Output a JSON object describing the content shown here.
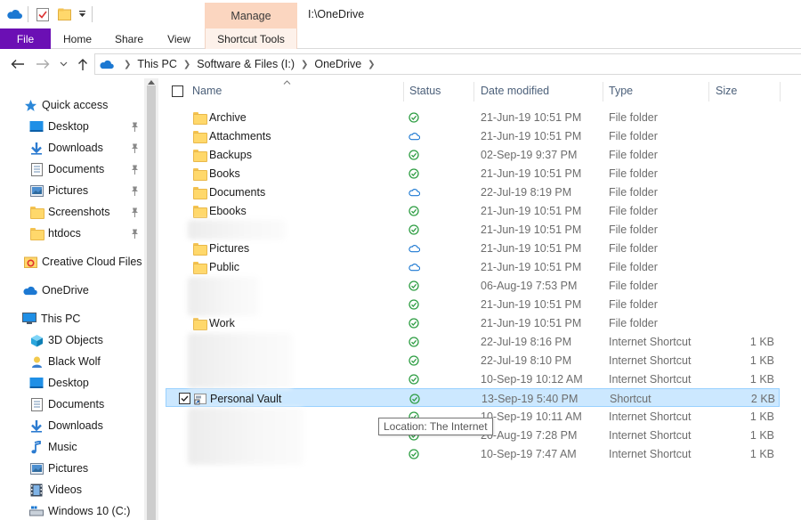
{
  "window": {
    "title": "I:\\OneDrive",
    "manage_tab": "Manage"
  },
  "ribbon": {
    "tabs": [
      "File",
      "Home",
      "Share",
      "View",
      "Shortcut Tools"
    ]
  },
  "address": {
    "crumbs": [
      "This PC",
      "Software & Files (I:)",
      "OneDrive"
    ]
  },
  "navpane": {
    "quick_access": "Quick access",
    "pinned": [
      "Desktop",
      "Downloads",
      "Documents",
      "Pictures",
      "Screenshots",
      "htdocs"
    ],
    "creative_cloud": "Creative Cloud Files",
    "onedrive": "OneDrive",
    "this_pc": "This PC",
    "this_pc_items": [
      "3D Objects",
      "Black Wolf",
      "Desktop",
      "Documents",
      "Downloads",
      "Music",
      "Pictures",
      "Videos",
      "Windows 10 (C:)"
    ]
  },
  "columns": {
    "name": "Name",
    "status": "Status",
    "date": "Date modified",
    "type": "Type",
    "size": "Size"
  },
  "files": [
    {
      "name": "Archive",
      "status": "synced",
      "date": "21-Jun-19 10:51 PM",
      "type": "File folder",
      "size": ""
    },
    {
      "name": "Attachments",
      "status": "cloud",
      "date": "21-Jun-19 10:51 PM",
      "type": "File folder",
      "size": ""
    },
    {
      "name": "Backups",
      "status": "synced",
      "date": "02-Sep-19 9:37 PM",
      "type": "File folder",
      "size": ""
    },
    {
      "name": "Books",
      "status": "synced",
      "date": "21-Jun-19 10:51 PM",
      "type": "File folder",
      "size": ""
    },
    {
      "name": "Documents",
      "status": "cloud",
      "date": "22-Jul-19 8:19 PM",
      "type": "File folder",
      "size": ""
    },
    {
      "name": "Ebooks",
      "status": "synced",
      "date": "21-Jun-19 10:51 PM",
      "type": "File folder",
      "size": ""
    },
    {
      "name": "",
      "status": "synced",
      "date": "21-Jun-19 10:51 PM",
      "type": "File folder",
      "size": ""
    },
    {
      "name": "Pictures",
      "status": "cloud",
      "date": "21-Jun-19 10:51 PM",
      "type": "File folder",
      "size": ""
    },
    {
      "name": "Public",
      "status": "cloud",
      "date": "21-Jun-19 10:51 PM",
      "type": "File folder",
      "size": ""
    },
    {
      "name": "",
      "status": "synced",
      "date": "06-Aug-19 7:53 PM",
      "type": "File folder",
      "size": ""
    },
    {
      "name": "",
      "status": "synced",
      "date": "21-Jun-19 10:51 PM",
      "type": "File folder",
      "size": ""
    },
    {
      "name": "Work",
      "status": "synced",
      "date": "21-Jun-19 10:51 PM",
      "type": "File folder",
      "size": ""
    },
    {
      "name": "",
      "status": "synced",
      "date": "22-Jul-19 8:16 PM",
      "type": "Internet Shortcut",
      "size": "1 KB"
    },
    {
      "name": "",
      "status": "synced",
      "date": "22-Jul-19 8:10 PM",
      "type": "Internet Shortcut",
      "size": "1 KB"
    },
    {
      "name": "",
      "status": "synced",
      "date": "10-Sep-19 10:12 AM",
      "type": "Internet Shortcut",
      "size": "1 KB"
    },
    {
      "name": "Personal Vault",
      "status": "synced",
      "date": "13-Sep-19 5:40 PM",
      "type": "Shortcut",
      "size": "2 KB"
    },
    {
      "name": "",
      "status": "synced",
      "date": "10-Sep-19 10:11 AM",
      "type": "Internet Shortcut",
      "size": "1 KB"
    },
    {
      "name": "",
      "status": "synced",
      "date": "20-Aug-19 7:28 PM",
      "type": "Internet Shortcut",
      "size": "1 KB"
    },
    {
      "name": "",
      "status": "synced",
      "date": "10-Sep-19 7:47 AM",
      "type": "Internet Shortcut",
      "size": "1 KB"
    }
  ],
  "tooltip": "Location: The Internet",
  "colors": {
    "file_tab": "#6b0fb4",
    "manage_tab": "#fbd6c0",
    "selection": "#cce8ff",
    "synced": "#2f9e44",
    "cloud": "#1c78d2"
  },
  "icons": {
    "synced": "green-check-circle-icon",
    "cloud": "onedrive-cloud-icon",
    "folder": "folder-icon"
  }
}
